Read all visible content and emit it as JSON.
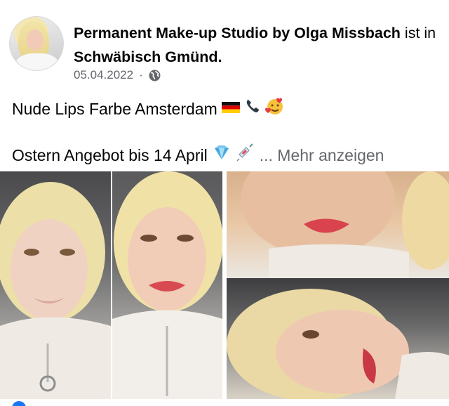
{
  "post": {
    "page_name_part1": "Permanent Make-up Studio by Olga Missbach",
    "connector": " ist in ",
    "location": "Schwäbisch Gmünd.",
    "date": "05.04.2022",
    "audience_icon": "globe-icon",
    "text_line1": "Nude Lips Farbe Amsterdam",
    "text_line1_emojis": [
      "🇩🇪",
      "📞",
      "🥰"
    ],
    "text_line2": "Ostern Angebot bis 14 April",
    "text_line2_emojis": [
      "💎",
      "💉"
    ],
    "more_link": "... Mehr anzeigen"
  },
  "photos": {
    "count": 4,
    "items": [
      "photo-before-front",
      "photo-after-front",
      "photo-lips-closeup",
      "photo-lips-side"
    ]
  },
  "colors": {
    "text": "#050505",
    "secondary": "#65676b",
    "link": "#1877f2",
    "background": "#ffffff"
  }
}
